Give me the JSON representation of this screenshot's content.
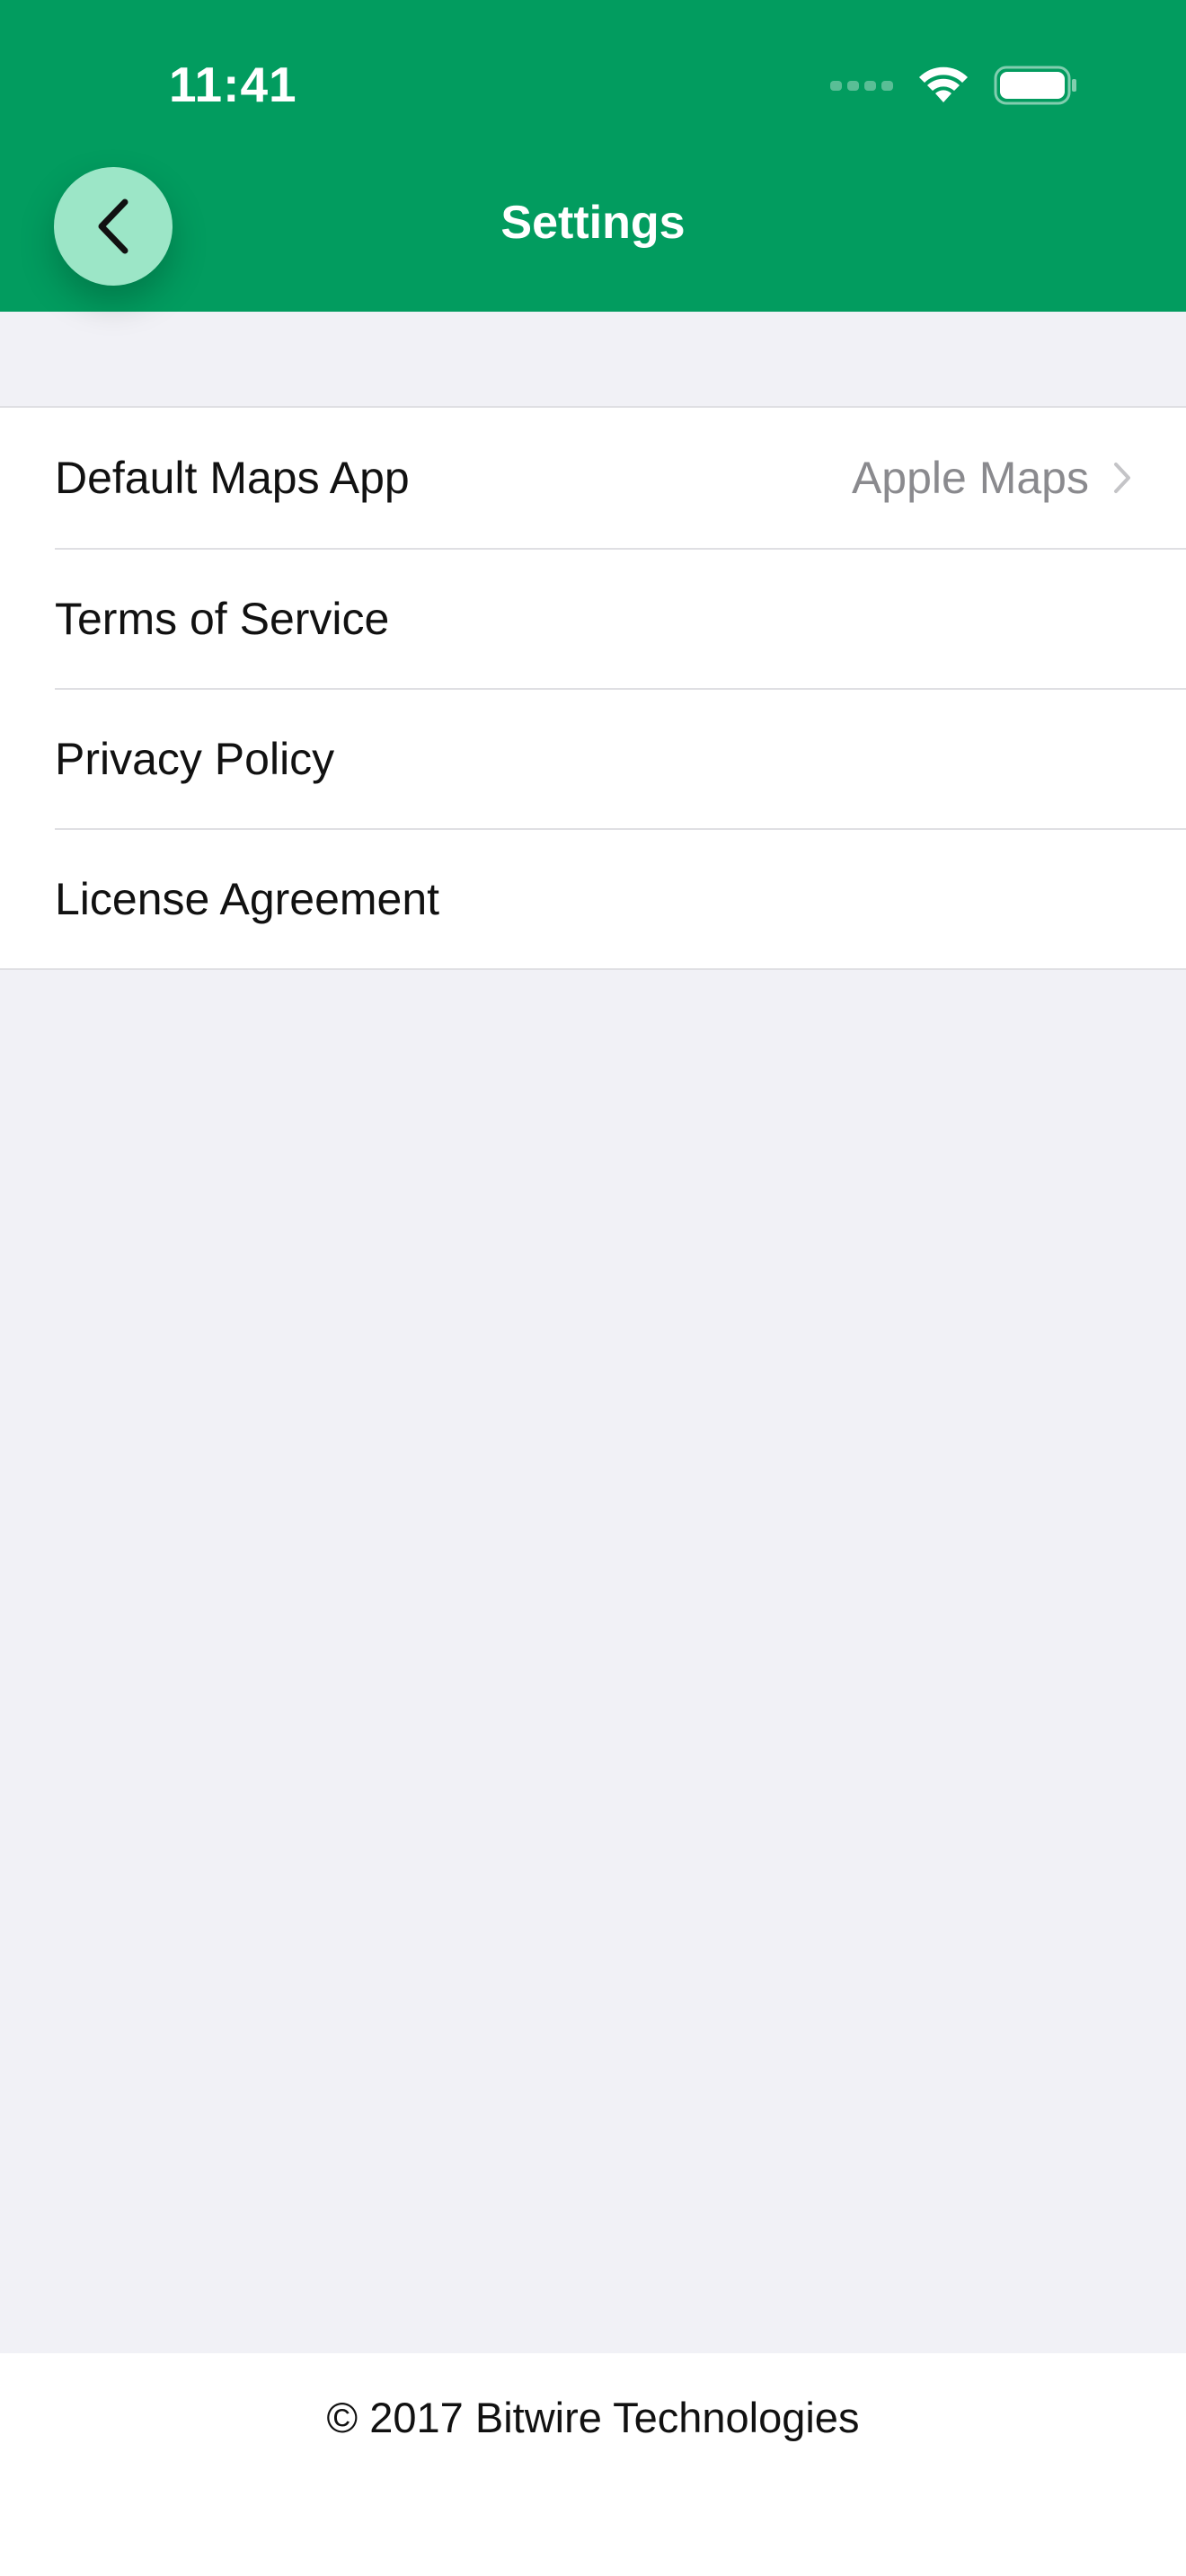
{
  "status_bar": {
    "time": "11:41"
  },
  "header": {
    "title": "Settings",
    "back_icon": "chevron-left-icon",
    "background_color": "#029c5f",
    "back_button_color": "#9ce6c7"
  },
  "settings": {
    "rows": [
      {
        "label": "Default Maps App",
        "value": "Apple Maps"
      },
      {
        "label": "Terms of Service"
      },
      {
        "label": "Privacy Policy"
      },
      {
        "label": "License Agreement"
      }
    ]
  },
  "footer": {
    "copyright": "© 2017 Bitwire Technologies"
  }
}
